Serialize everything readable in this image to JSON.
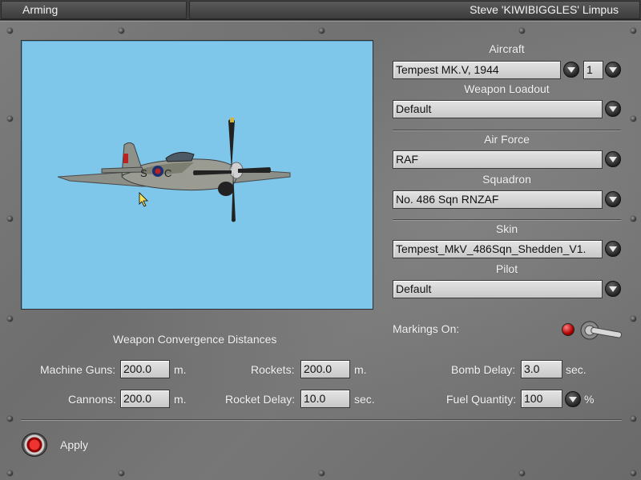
{
  "titlebar": {
    "left_title": "Arming",
    "right_title": "Steve 'KIWIBIGGLES' Limpus"
  },
  "aircraft": {
    "label": "Aircraft",
    "type_value": "Tempest MK.V, 1944",
    "count_value": "1"
  },
  "weapon_loadout": {
    "label": "Weapon Loadout",
    "value": "Default"
  },
  "air_force": {
    "label": "Air Force",
    "value": "RAF"
  },
  "squadron": {
    "label": "Squadron",
    "value": "No. 486 Sqn RNZAF"
  },
  "skin": {
    "label": "Skin",
    "value": "Tempest_MkV_486Sqn_Shedden_V1."
  },
  "pilot": {
    "label": "Pilot",
    "value": "Default"
  },
  "markings": {
    "label": "Markings On:"
  },
  "convergence": {
    "title": "Weapon Convergence Distances",
    "machine_guns": {
      "label": "Machine Guns:",
      "value": "200.0",
      "unit": "m."
    },
    "cannons": {
      "label": "Cannons:",
      "value": "200.0",
      "unit": "m."
    },
    "rockets": {
      "label": "Rockets:",
      "value": "200.0",
      "unit": "m."
    },
    "rocket_delay": {
      "label": "Rocket Delay:",
      "value": "10.0",
      "unit": "sec."
    },
    "bomb_delay": {
      "label": "Bomb Delay:",
      "value": "3.0",
      "unit": "sec."
    },
    "fuel_quantity": {
      "label": "Fuel Quantity:",
      "value": "100",
      "unit": "%"
    }
  },
  "apply": {
    "label": "Apply"
  },
  "aircraft_roundel": "C"
}
